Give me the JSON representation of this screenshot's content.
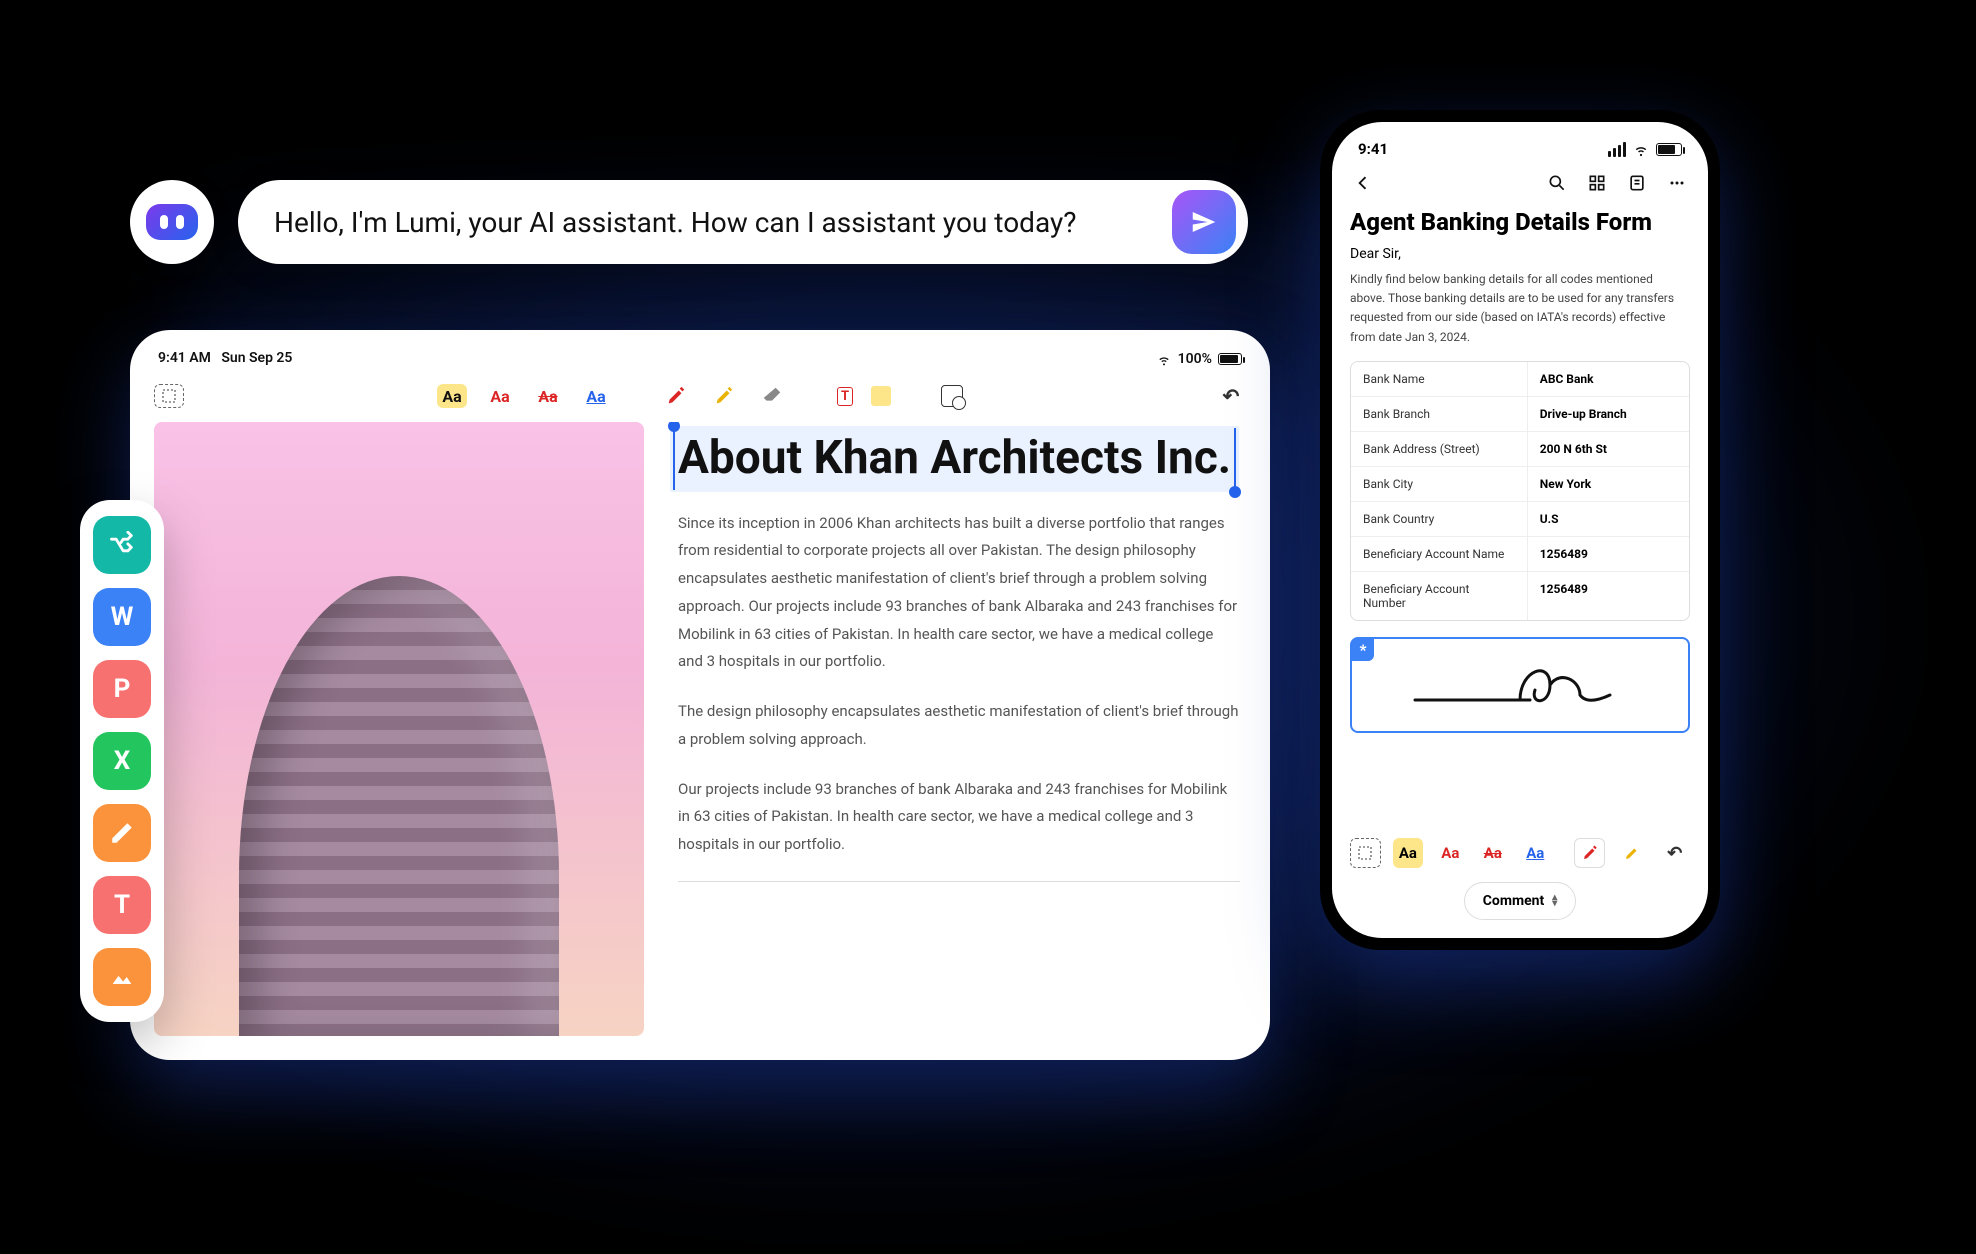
{
  "ai": {
    "greeting": "Hello, I'm Lumi, your AI assistant. How can I assistant you today?"
  },
  "tablet": {
    "status": {
      "time": "9:41 AM",
      "date": "Sun Sep 25",
      "battery_pct": "100%"
    },
    "toolbar": {
      "aa": "Aa",
      "textbox": "T"
    },
    "doc": {
      "title": "About Khan Architects Inc.",
      "p1": "Since its inception in 2006 Khan architects has built a diverse portfolio that ranges from residential to corporate projects all over Pakistan. The design philosophy encapsulates aesthetic manifestation of client's brief through a problem solving approach. Our projects include 93 branches of bank Albaraka and 243 franchises for Mobilink in 63 cities of Pakistan. In health care sector, we have a medical college and 3 hospitals in our portfolio.",
      "p2": "The design philosophy encapsulates aesthetic manifestation of client's brief through a problem solving approach.",
      "p3": "Our projects include 93 branches of bank Albaraka and 243 franchises for Mobilink in 63 cities of Pakistan. In health care sector, we have a medical college and 3 hospitals in our portfolio."
    }
  },
  "dock": {
    "items": [
      {
        "label": "",
        "icon": "shuffle"
      },
      {
        "label": "W",
        "icon": "word"
      },
      {
        "label": "P",
        "icon": "ppt"
      },
      {
        "label": "X",
        "icon": "excel"
      },
      {
        "label": "",
        "icon": "edit"
      },
      {
        "label": "T",
        "icon": "text"
      },
      {
        "label": "",
        "icon": "image"
      }
    ]
  },
  "phone": {
    "status": {
      "time": "9:41"
    },
    "form": {
      "title": "Agent Banking Details Form",
      "salutation": "Dear Sir,",
      "description": "Kindly find below banking details for all codes mentioned above. Those banking details are to be used for any transfers requested from our side (based on IATA's records) effective from date Jan 3, 2024.",
      "rows": [
        {
          "k": "Bank Name",
          "v": "ABC Bank"
        },
        {
          "k": "Bank Branch",
          "v": "Drive-up Branch"
        },
        {
          "k": "Bank Address (Street)",
          "v": "200 N 6th St"
        },
        {
          "k": "Bank City",
          "v": "New York"
        },
        {
          "k": "Bank Country",
          "v": "U.S"
        },
        {
          "k": "Beneficiary Account Name",
          "v": "1256489"
        },
        {
          "k": "Beneficiary Account Number",
          "v": "1256489"
        }
      ]
    },
    "toolbar": {
      "aa": "Aa"
    },
    "comment_label": "Comment",
    "sig_badge": "*"
  }
}
